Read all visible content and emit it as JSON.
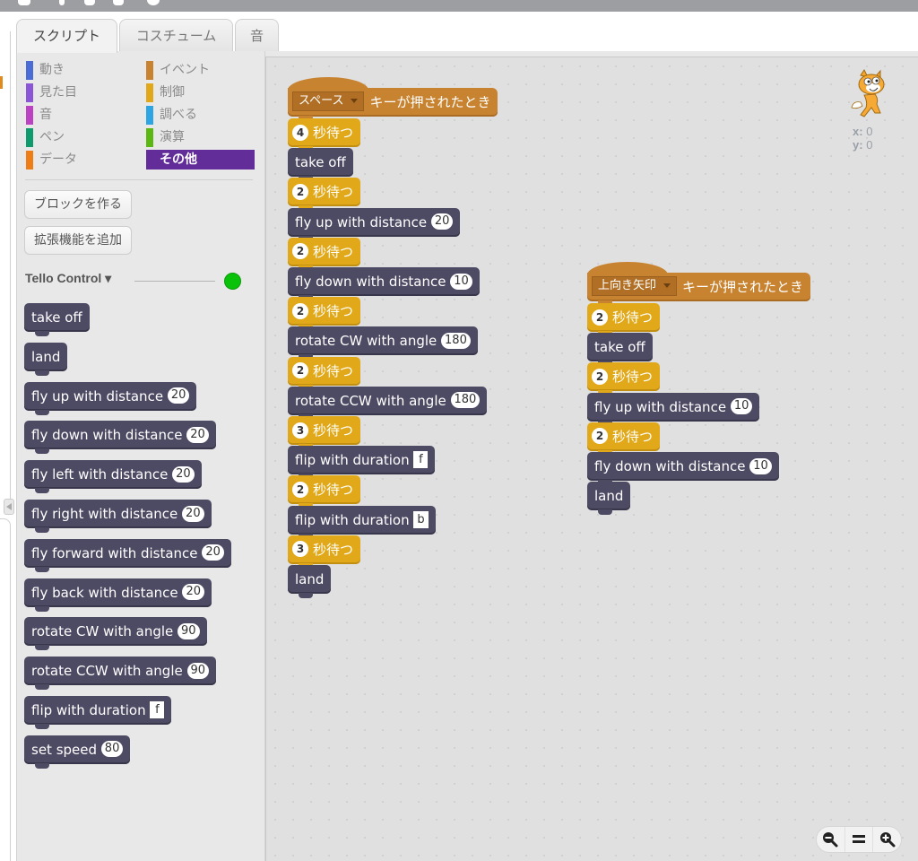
{
  "tabs": [
    {
      "label": "スクリプト",
      "active": true
    },
    {
      "label": "コスチューム",
      "active": false
    },
    {
      "label": "音",
      "active": false
    }
  ],
  "categories": [
    {
      "label": "動き",
      "color": "#4a6cd4"
    },
    {
      "label": "見た目",
      "color": "#8a55d7"
    },
    {
      "label": "音",
      "color": "#bb42c3"
    },
    {
      "label": "ペン",
      "color": "#0e9a6c"
    },
    {
      "label": "データ",
      "color": "#ee7d16"
    },
    {
      "label": "イベント",
      "color": "#c88330"
    },
    {
      "label": "制御",
      "color": "#e1a91a"
    },
    {
      "label": "調べる",
      "color": "#2ca5e2"
    },
    {
      "label": "演算",
      "color": "#5cb712"
    },
    {
      "label": "その他",
      "color": "#632d99",
      "selected": true
    }
  ],
  "palette_buttons": {
    "make_block": "ブロックを作る",
    "add_extension": "拡張機能を追加"
  },
  "extension": {
    "title": "Tello Control ▾",
    "status_color": "#0bc20b"
  },
  "palette_blocks": [
    {
      "text": "take off"
    },
    {
      "text": "land"
    },
    {
      "text": "fly up with distance",
      "arg": "20",
      "argType": "num"
    },
    {
      "text": "fly down with distance",
      "arg": "20",
      "argType": "num"
    },
    {
      "text": "fly left with distance",
      "arg": "20",
      "argType": "num"
    },
    {
      "text": "fly right with distance",
      "arg": "20",
      "argType": "num"
    },
    {
      "text": "fly forward with distance",
      "arg": "20",
      "argType": "num"
    },
    {
      "text": "fly back with distance",
      "arg": "20",
      "argType": "num"
    },
    {
      "text": "rotate CW with angle",
      "arg": "90",
      "argType": "num"
    },
    {
      "text": "rotate CCW with angle",
      "arg": "90",
      "argType": "num"
    },
    {
      "text": "flip with duration",
      "arg": "f",
      "argType": "text"
    },
    {
      "text": "set speed",
      "arg": "80",
      "argType": "num"
    }
  ],
  "wait_label": "秒待つ",
  "hat_suffix": "キーが押されたとき",
  "scripts": [
    {
      "key": "スペース",
      "blocks": [
        {
          "type": "wait",
          "arg": "4"
        },
        {
          "type": "drone",
          "text": "take off"
        },
        {
          "type": "wait",
          "arg": "2"
        },
        {
          "type": "drone",
          "text": "fly up with distance",
          "arg": "20",
          "argType": "num"
        },
        {
          "type": "wait",
          "arg": "2"
        },
        {
          "type": "drone",
          "text": "fly down with distance",
          "arg": "10",
          "argType": "num"
        },
        {
          "type": "wait",
          "arg": "2"
        },
        {
          "type": "drone",
          "text": "rotate CW with angle",
          "arg": "180",
          "argType": "num"
        },
        {
          "type": "wait",
          "arg": "2"
        },
        {
          "type": "drone",
          "text": "rotate CCW with angle",
          "arg": "180",
          "argType": "num"
        },
        {
          "type": "wait",
          "arg": "3"
        },
        {
          "type": "drone",
          "text": "flip with duration",
          "arg": "f",
          "argType": "text"
        },
        {
          "type": "wait",
          "arg": "2"
        },
        {
          "type": "drone",
          "text": "flip with duration",
          "arg": "b",
          "argType": "text"
        },
        {
          "type": "wait",
          "arg": "3"
        },
        {
          "type": "drone",
          "text": "land"
        }
      ]
    },
    {
      "key": "上向き矢印",
      "blocks": [
        {
          "type": "wait",
          "arg": "2"
        },
        {
          "type": "drone",
          "text": "take off"
        },
        {
          "type": "wait",
          "arg": "2"
        },
        {
          "type": "drone",
          "text": "fly up with distance",
          "arg": "10",
          "argType": "num"
        },
        {
          "type": "wait",
          "arg": "2"
        },
        {
          "type": "drone",
          "text": "fly down with distance",
          "arg": "10",
          "argType": "num"
        },
        {
          "type": "drone",
          "text": "land"
        }
      ]
    }
  ],
  "sprite_info": {
    "x_label": "x:",
    "x_value": "0",
    "y_label": "y:",
    "y_value": "0"
  },
  "zoom_controls": [
    "zoom-out",
    "zoom-reset",
    "zoom-in"
  ]
}
